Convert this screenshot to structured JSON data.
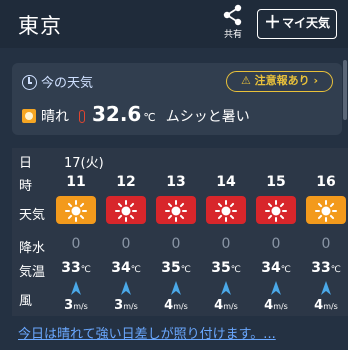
{
  "header": {
    "city": "東京",
    "share_label": "共有",
    "my_weather_label": "マイ天気"
  },
  "now": {
    "title": "今の天気",
    "warning": "注意報あり",
    "weather": "晴れ",
    "temperature": "32.6",
    "temp_unit": "℃",
    "comment": "ムシッと暑い"
  },
  "forecast": {
    "labels": {
      "day": "日",
      "hour": "時",
      "weather": "天気",
      "rain": "降水",
      "temp": "気温",
      "wind": "風"
    },
    "date": "17(火)",
    "temp_unit": "℃",
    "wind_unit": "m/s",
    "hours": [
      {
        "hour": "11",
        "icon": "sun-icon",
        "bg": "#f39a1c",
        "rain": "0",
        "temp": "33",
        "wind": "3"
      },
      {
        "hour": "12",
        "icon": "sun-icon",
        "bg": "#d8262b",
        "rain": "0",
        "temp": "34",
        "wind": "3"
      },
      {
        "hour": "13",
        "icon": "sun-icon",
        "bg": "#d8262b",
        "rain": "0",
        "temp": "35",
        "wind": "4"
      },
      {
        "hour": "14",
        "icon": "sun-icon",
        "bg": "#d8262b",
        "rain": "0",
        "temp": "35",
        "wind": "4"
      },
      {
        "hour": "15",
        "icon": "sun-icon",
        "bg": "#d8262b",
        "rain": "0",
        "temp": "34",
        "wind": "4"
      },
      {
        "hour": "16",
        "icon": "sun-icon",
        "bg": "#f39a1c",
        "rain": "0",
        "temp": "33",
        "wind": "4"
      }
    ]
  },
  "footer": {
    "text": "今日は晴れて強い日差しが照り付けます。..."
  },
  "colors": {
    "header_bg": "#1f2b3a",
    "page_bg": "#243142",
    "card_bg": "#313e4f",
    "warn": "#e9c13a",
    "link": "#6aa8ff",
    "wind_arrow": "#4aa8e8"
  }
}
